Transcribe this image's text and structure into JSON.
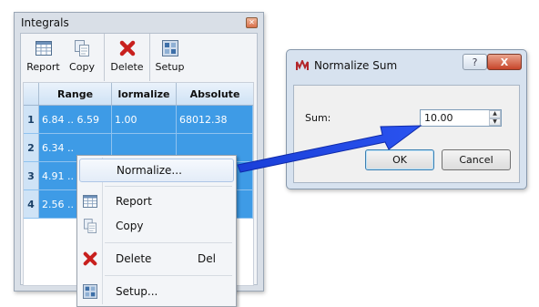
{
  "integrals": {
    "title": "Integrals",
    "toolbar": [
      {
        "label": "Report",
        "icon": "report-icon"
      },
      {
        "label": "Copy",
        "icon": "copy-icon"
      },
      {
        "label": "Delete",
        "icon": "delete-icon"
      },
      {
        "label": "Setup",
        "icon": "setup-icon"
      }
    ],
    "columns": [
      "",
      "Range",
      "lormalize",
      "Absolute"
    ],
    "rows": [
      {
        "num": "1",
        "range": "6.84 .. 6.59",
        "normalized": "1.00",
        "absolute": "68012.38"
      },
      {
        "num": "2",
        "range": "6.34 ..",
        "normalized": "",
        "absolute": ""
      },
      {
        "num": "3",
        "range": "4.91 ..",
        "normalized": "",
        "absolute": ""
      },
      {
        "num": "4",
        "range": "2.56 ..",
        "normalized": "",
        "absolute": ""
      }
    ]
  },
  "context_menu": {
    "items": [
      {
        "label": "Normalize...",
        "shortcut": "",
        "icon": ""
      },
      {
        "label": "Report",
        "shortcut": "",
        "icon": "report-icon"
      },
      {
        "label": "Copy",
        "shortcut": "",
        "icon": "copy-icon"
      },
      {
        "label": "Delete",
        "shortcut": "Del",
        "icon": "delete-icon"
      },
      {
        "label": "Setup...",
        "shortcut": "",
        "icon": "setup-icon"
      }
    ]
  },
  "dialog": {
    "title": "Normalize Sum",
    "help_label": "?",
    "close_label": "X",
    "sum_label": "Sum:",
    "sum_value": "10.00",
    "ok_label": "OK",
    "cancel_label": "Cancel"
  },
  "colors": {
    "selection": "#3e9be6",
    "arrow": "#1f3fd6",
    "delete_red": "#c8201e"
  }
}
